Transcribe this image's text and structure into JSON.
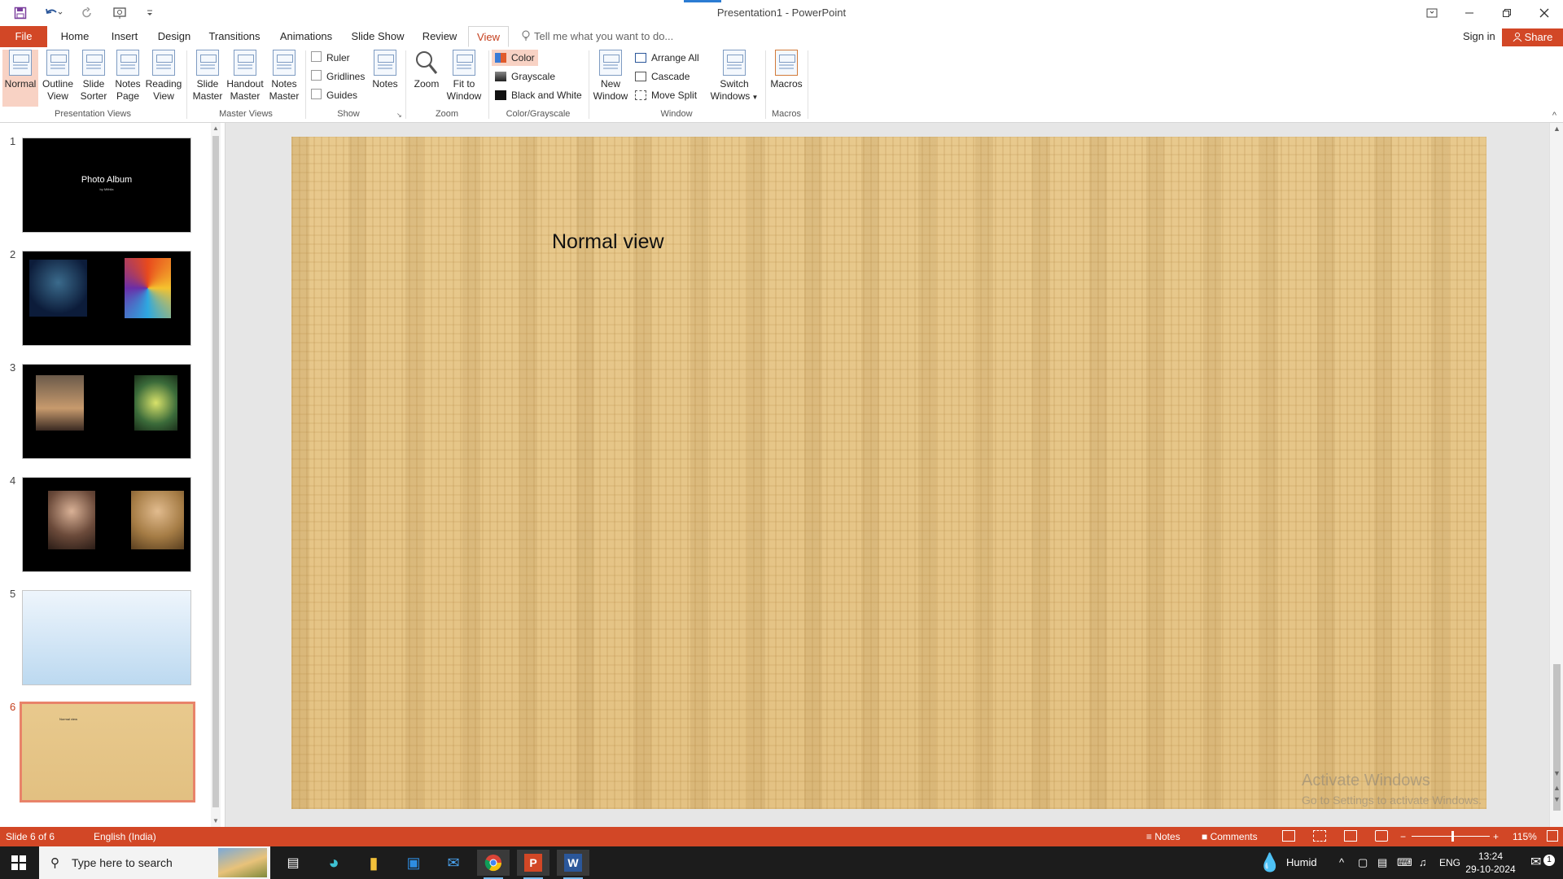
{
  "window": {
    "title": "Presentation1 - PowerPoint",
    "qat_icons": [
      "save-icon",
      "undo-icon",
      "redo-icon",
      "present-from-beginning-icon",
      "customize-qat-icon"
    ],
    "controls": [
      "ribbon-display-options-icon",
      "minimize-icon",
      "restore-icon",
      "close-icon"
    ]
  },
  "tabs": {
    "file": "File",
    "items": [
      "Home",
      "Insert",
      "Design",
      "Transitions",
      "Animations",
      "Slide Show",
      "Review",
      "View"
    ],
    "active": "View",
    "tell_me": "Tell me what you want to do...",
    "sign_in": "Sign in",
    "share": "Share"
  },
  "ribbon": {
    "presentation_views": {
      "label": "Presentation Views",
      "normal": "Normal",
      "outline_1": "Outline",
      "outline_2": "View",
      "sorter_1": "Slide",
      "sorter_2": "Sorter",
      "notespage_1": "Notes",
      "notespage_2": "Page",
      "reading_1": "Reading",
      "reading_2": "View"
    },
    "master_views": {
      "label": "Master Views",
      "slide_1": "Slide",
      "slide_2": "Master",
      "handout_1": "Handout",
      "handout_2": "Master",
      "notes_1": "Notes",
      "notes_2": "Master"
    },
    "show": {
      "label": "Show",
      "ruler": "Ruler",
      "gridlines": "Gridlines",
      "guides": "Guides",
      "notes": "Notes"
    },
    "zoom": {
      "label": "Zoom",
      "zoom": "Zoom",
      "fit_1": "Fit to",
      "fit_2": "Window"
    },
    "color_grayscale": {
      "label": "Color/Grayscale",
      "color": "Color",
      "grayscale": "Grayscale",
      "bw": "Black and White"
    },
    "window": {
      "label": "Window",
      "new_1": "New",
      "new_2": "Window",
      "arrange": "Arrange All",
      "cascade": "Cascade",
      "split": "Move Split",
      "switch_1": "Switch",
      "switch_2": "Windows"
    },
    "macros": {
      "label": "Macros",
      "macros": "Macros"
    }
  },
  "slides": [
    {
      "num": "1",
      "title": "Photo Album",
      "subtitle": "by Mithila"
    },
    {
      "num": "2"
    },
    {
      "num": "3"
    },
    {
      "num": "4"
    },
    {
      "num": "5"
    },
    {
      "num": "6",
      "title": "Normal view"
    }
  ],
  "current_slide": {
    "title": "Normal view"
  },
  "watermark": {
    "line1": "Activate Windows",
    "line2": "Go to Settings to activate Windows."
  },
  "status": {
    "slide_of": "Slide 6 of 6",
    "language": "English (India)",
    "notes": "Notes",
    "comments": "Comments",
    "zoom_level": "115%",
    "zoom_fraction": 0.55
  },
  "taskbar": {
    "search_placeholder": "Type here to search",
    "weather": "Humid",
    "lang": "ENG",
    "time": "13:24",
    "date": "29-10-2024",
    "notification_count": "1",
    "apps": [
      "task-view-icon",
      "edge-icon",
      "file-explorer-icon",
      "store-icon",
      "mail-icon",
      "chrome-icon",
      "powerpoint-icon",
      "word-icon"
    ]
  },
  "colors": {
    "accent": "#d24726",
    "active_tab_text": "#c43e1c",
    "selected_button": "#f8d2c4",
    "slide_background": "#e6c688"
  }
}
